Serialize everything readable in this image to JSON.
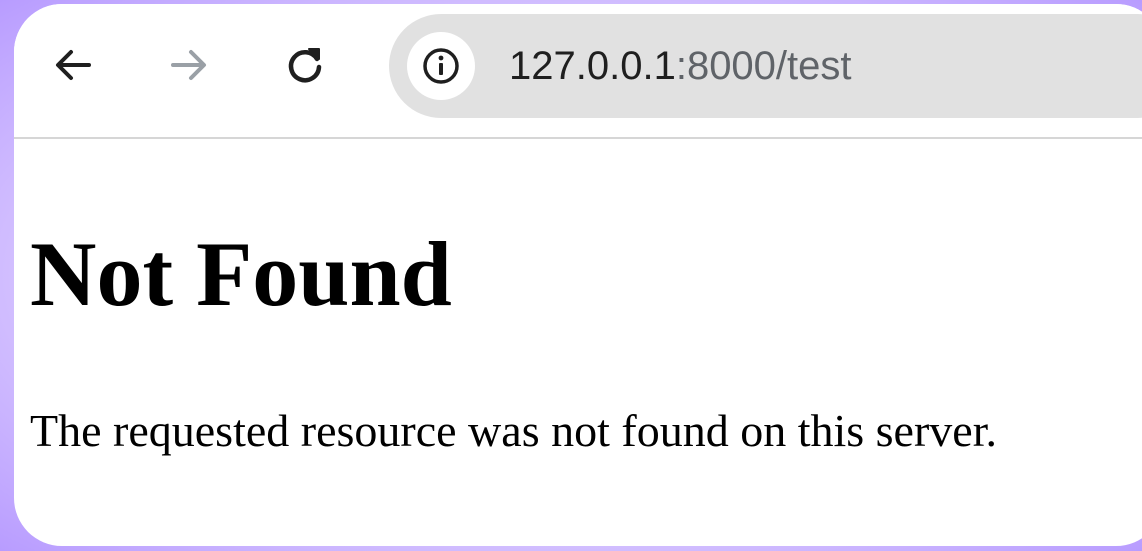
{
  "colors": {
    "background_glow": "#c9b3ff",
    "toolbar_bg": "#ffffff",
    "omnibox_bg": "#e1e1e1",
    "icon_active": "#1f1f1f",
    "icon_disabled": "#9aa0a6",
    "url_host": "#1f1f1f",
    "url_rest": "#5f6368"
  },
  "toolbar": {
    "back_icon": "arrow-left-icon",
    "forward_icon": "arrow-right-icon",
    "reload_icon": "reload-icon",
    "forward_enabled": false
  },
  "omnibox": {
    "info_icon": "info-icon",
    "url_host": "127.0.0.1",
    "url_rest": ":8000/test"
  },
  "page": {
    "heading": "Not Found",
    "message": "The requested resource was not found on this server."
  }
}
